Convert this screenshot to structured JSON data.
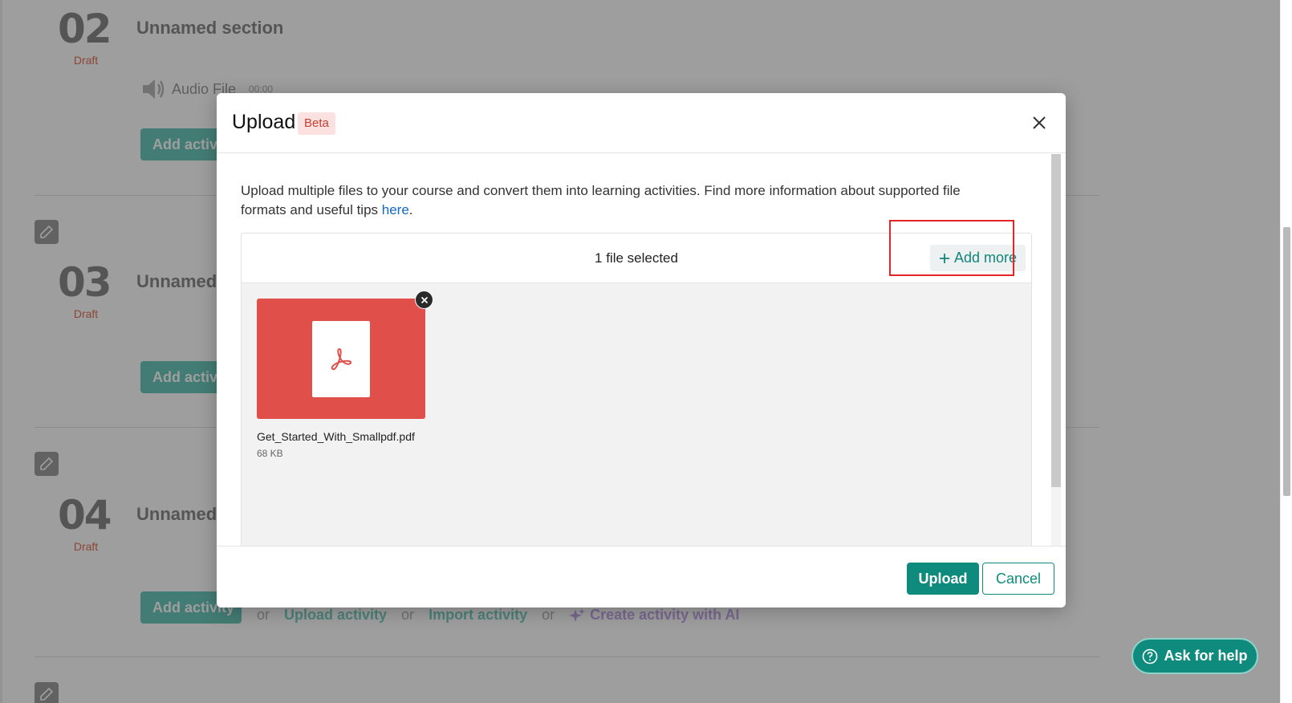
{
  "page": {
    "sections": [
      {
        "number": "02",
        "status": "Draft",
        "title": "Unnamed section"
      },
      {
        "number": "03",
        "status": "Draft",
        "title": "Unnamed section"
      },
      {
        "number": "04",
        "status": "Draft",
        "title": "Unnamed section"
      }
    ],
    "audio_item": {
      "label": "Audio File",
      "duration": "00:00"
    },
    "add_activity_label": "Add activity",
    "or_label": "or",
    "upload_activity_label": "Upload activity",
    "import_activity_label": "Import activity",
    "create_ai_label": "Create activity with AI",
    "help_label": "Ask for help"
  },
  "modal": {
    "title": "Upload",
    "badge": "Beta",
    "intro_text": "Upload multiple files to your course and convert them into learning activities. Find more information about supported file formats and useful tips ",
    "intro_link": "here",
    "intro_end": ".",
    "files_selected": "1 file selected",
    "add_more_label": "Add more",
    "files": [
      {
        "name": "Get_Started_With_Smallpdf.pdf",
        "size": "68 KB",
        "type": "pdf"
      }
    ],
    "upload_label": "Upload",
    "cancel_label": "Cancel"
  },
  "colors": {
    "accent": "#0f8b7d",
    "pdf_thumb": "#e04f4a",
    "highlight": "#e52525",
    "link": "#1467c6"
  }
}
